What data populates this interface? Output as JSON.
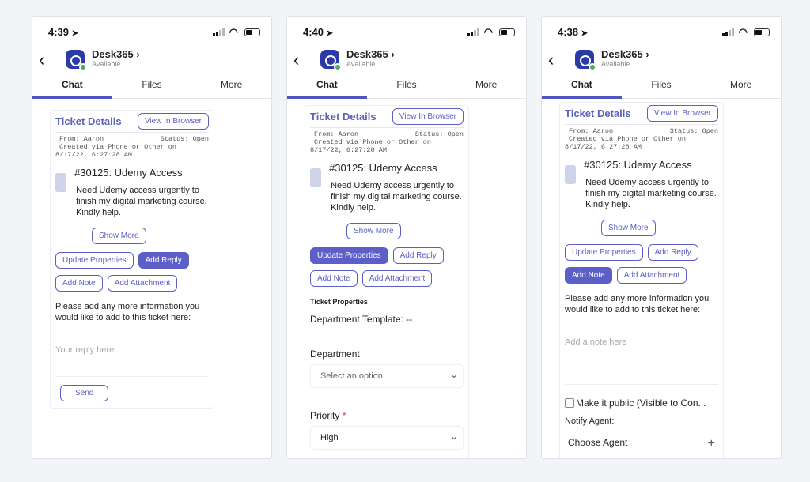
{
  "phones": [
    {
      "time": "4:39",
      "active_button": "add_reply",
      "view": "reply",
      "reply": {
        "prompt": "Please add any more information you would like to add to this ticket here:",
        "placeholder": "Your reply here",
        "send": "Send"
      }
    },
    {
      "time": "4:40",
      "active_button": "update_properties",
      "view": "properties",
      "properties": {
        "heading": "Ticket Properties",
        "template": "Department Template: --",
        "department_label": "Department",
        "department_value": "Select an option",
        "priority_label": "Priority",
        "priority_required": "*",
        "priority_value": "High"
      }
    },
    {
      "time": "4:38",
      "active_button": "add_note",
      "view": "note",
      "note": {
        "prompt": "Please add any more information you would like to add to this ticket here:",
        "placeholder": "Add a note here",
        "public_checkbox": "Make it public (Visible to Con...",
        "public_checked": false,
        "notify_label": "Notify Agent:",
        "choose_agent": "Choose Agent"
      }
    }
  ],
  "header": {
    "app_name": "Desk365 ›",
    "presence": "Available",
    "tabs": [
      "Chat",
      "Files",
      "More"
    ],
    "active_tab": "Chat"
  },
  "ticket": {
    "title": "Ticket Details",
    "view_in_browser": "View In Browser",
    "from": "From: Aaron",
    "status": "Status: Open",
    "created": "Created via Phone or Other on",
    "created_date": "8/17/22, 6:27:28 AM",
    "number_subject": "#30125: Udemy Access",
    "description": "Need Udemy access urgently to finish my digital marketing course. Kindly help.",
    "show_more": "Show More"
  },
  "buttons": {
    "update_properties": "Update Properties",
    "add_reply": "Add Reply",
    "add_note": "Add Note",
    "add_attachment": "Add Attachment"
  },
  "colors": {
    "accent": "#5b5fc7",
    "brand": "#2c3aa8",
    "presence": "#4caf50"
  }
}
